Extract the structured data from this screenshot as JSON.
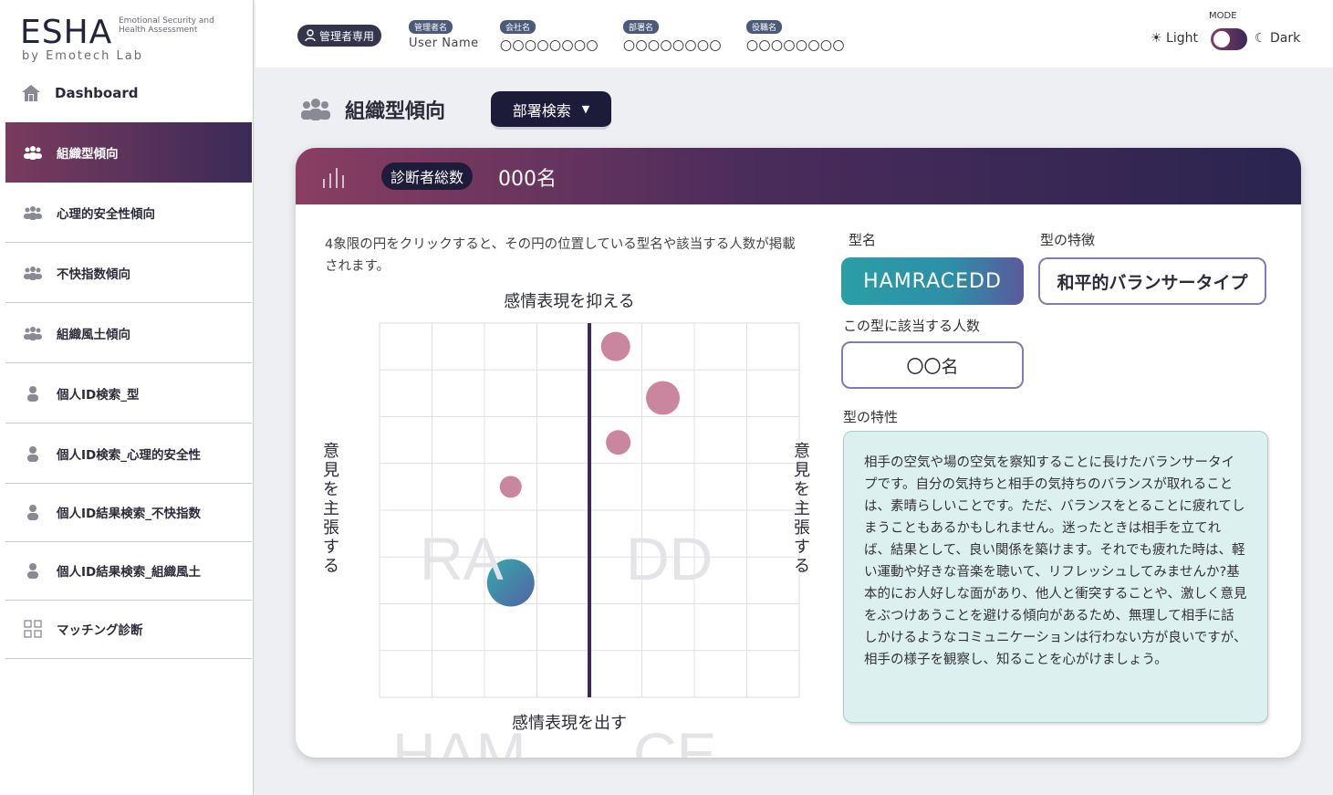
{
  "sidebar": {
    "logo": {
      "main": "ESHA",
      "sub": "Emotional Security and Health Assessment",
      "by": "by Emotech Lab"
    },
    "dashboard": "Dashboard",
    "items": [
      {
        "label": "組織型傾向",
        "icon": "group-icon",
        "active": true
      },
      {
        "label": "心理的安全性傾向",
        "icon": "group-icon",
        "active": false
      },
      {
        "label": "不快指数傾向",
        "icon": "group-icon",
        "active": false
      },
      {
        "label": "組織風土傾向",
        "icon": "group-icon",
        "active": false
      },
      {
        "label": "個人ID検索_型",
        "icon": "person-icon",
        "active": false
      },
      {
        "label": "個人ID検索_心理的安全性",
        "icon": "person-icon",
        "active": false
      },
      {
        "label": "個人ID結果検索_不快指数",
        "icon": "person-icon",
        "active": false
      },
      {
        "label": "個人ID結果検索_組織風土",
        "icon": "person-icon",
        "active": false
      },
      {
        "label": "マッチング診断",
        "icon": "grid-icon",
        "active": false
      }
    ]
  },
  "topbar": {
    "admin_badge": "管理者専用",
    "fields": [
      {
        "tag": "管理者名",
        "value": "User Name"
      },
      {
        "tag": "会社名",
        "value": "〇〇〇〇〇〇〇〇"
      },
      {
        "tag": "部署名",
        "value": "〇〇〇〇〇〇〇〇"
      },
      {
        "tag": "役職名",
        "value": "〇〇〇〇〇〇〇〇"
      }
    ],
    "mode": {
      "label": "MODE",
      "light": "Light",
      "dark": "Dark"
    }
  },
  "page": {
    "title": "組織型傾向",
    "dept_button": "部署検索"
  },
  "card": {
    "pill": "診断者総数",
    "count": "000名",
    "instruction": "4象限の円をクリックすると、その円の位置している型名や該当する人数が掲載されます。"
  },
  "chart_data": {
    "type": "scatter",
    "axis_top": "感情表現を抑える",
    "axis_bottom": "感情表現を出す",
    "axis_left": "意見を主張する",
    "axis_right": "意見を主張する",
    "quadrants": [
      "RA",
      "DD",
      "HAM",
      "CE"
    ],
    "xlim": [
      -4,
      4
    ],
    "ylim": [
      -4,
      4
    ],
    "points": [
      {
        "x": 0.5,
        "y": 3.5,
        "size": 2,
        "color": "#c8809a"
      },
      {
        "x": 1.4,
        "y": 2.4,
        "size": 2.5,
        "color": "#c8809a"
      },
      {
        "x": 0.55,
        "y": 1.45,
        "size": 1.5,
        "color": "#c8809a"
      },
      {
        "x": -1.5,
        "y": 0.5,
        "size": 1.2,
        "color": "#c8809a"
      },
      {
        "x": -1.5,
        "y": -1.55,
        "size": 4,
        "color": "#2a9fa4"
      }
    ]
  },
  "detail": {
    "type_name_label": "型名",
    "type_name": "HAMRACEDD",
    "feature_label": "型の特徴",
    "feature": "和平的バランサータイプ",
    "people_label": "この型に該当する人数",
    "people": "〇〇名",
    "traits_label": "型の特性",
    "traits": "相手の空気や場の空気を察知することに長けたバランサータイプです。自分の気持ちと相手の気持ちのバランスが取れることは、素晴らしいことです。ただ、バランスをとることに疲れてしまうこともあるかもしれません。迷ったときは相手を立てれば、結果として、良い関係を築けます。それでも疲れた時は、軽い運動や好きな音楽を聴いて、リフレッシュしてみませんか?基本的にお人好しな面があり、他人と衝突することや、激しく意見をぶつけあうことを避ける傾向があるため、無理して相手に話しかけるようなコミュニケーションは行わない方が良いですが、相手の様子を観察し、知ることを心がけましょう。"
  }
}
